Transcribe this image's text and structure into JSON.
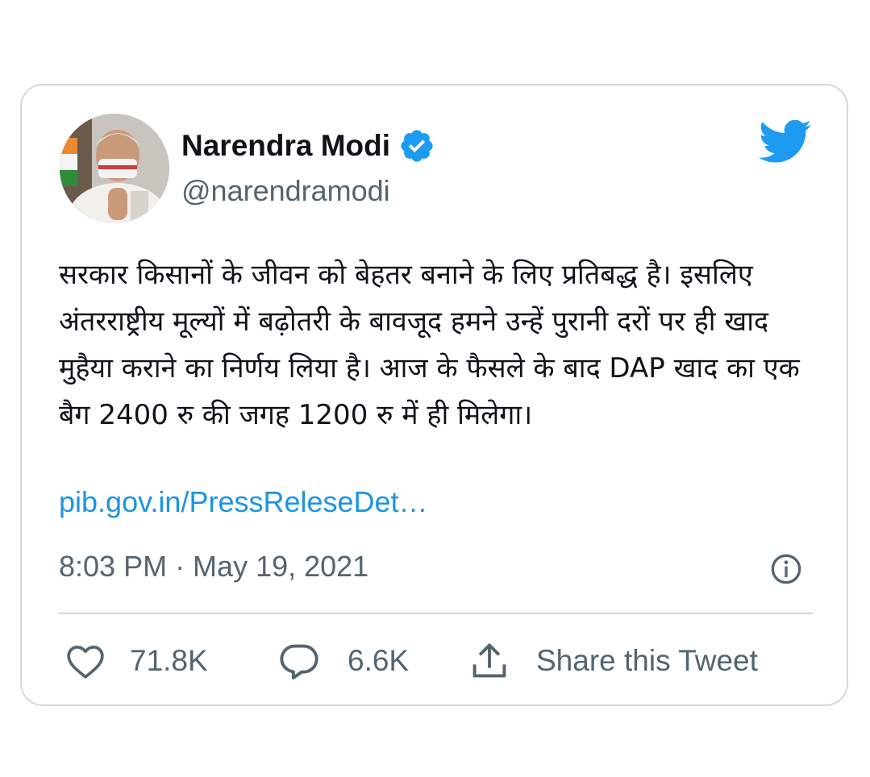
{
  "tweet": {
    "author_name": "Narendra Modi",
    "handle": "@narendramodi",
    "text": "सरकार किसानों के जीवन को बेहतर बनाने के लिए प्रतिबद्ध है। इसलिए अंतरराष्ट्रीय मूल्यों में बढ़ोतरी के बावजूद हमने उन्हें पुरानी दरों पर ही खाद मुहैया कराने का निर्णय लिया है। आज के फैसले के बाद DAP खाद का एक बैग 2400 रु की जगह 1200 रु में ही मिलेगा।",
    "link": "pib.gov.in/PressReleseDet…",
    "timestamp": "8:03 PM · May 19, 2021"
  },
  "actions": {
    "likes": "71.8K",
    "replies": "6.6K",
    "share_label": "Share this Tweet"
  },
  "icons": {
    "verified": "verified-badge-icon",
    "brand": "twitter-bird-icon",
    "info": "info-icon",
    "like": "heart-icon",
    "reply": "reply-bubble-icon",
    "share": "share-icon"
  },
  "colors": {
    "brand_blue": "#1d9bf0",
    "link_blue": "#1b95e0",
    "text_primary": "#0f1419",
    "text_secondary": "#536471",
    "border": "#cfd9de"
  }
}
